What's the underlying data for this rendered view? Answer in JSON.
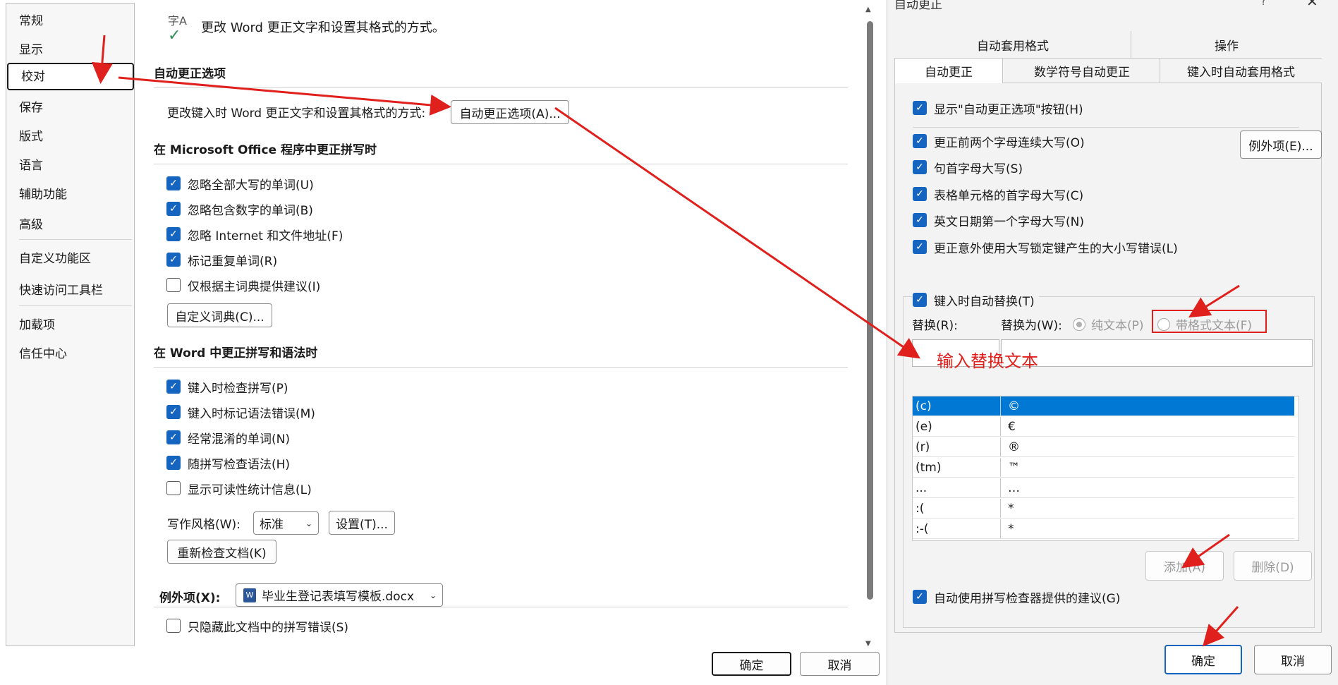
{
  "nav": {
    "items": [
      "常规",
      "显示",
      "校对",
      "保存",
      "版式",
      "语言",
      "辅助功能",
      "高级",
      "自定义功能区",
      "快速访问工具栏",
      "加载项",
      "信任中心"
    ],
    "selected": "校对"
  },
  "main": {
    "header_icon_text": "字A",
    "header_text": "更改 Word 更正文字和设置其格式的方式。",
    "autocorrect_section": {
      "title": "自动更正选项",
      "description": "更改键入时 Word 更正文字和设置其格式的方式:",
      "button": "自动更正选项(A)..."
    },
    "office_section": {
      "title": "在 Microsoft Office 程序中更正拼写时",
      "checkboxes": [
        {
          "label": "忽略全部大写的单词(U)",
          "checked": true
        },
        {
          "label": "忽略包含数字的单词(B)",
          "checked": true
        },
        {
          "label": "忽略 Internet 和文件地址(F)",
          "checked": true
        },
        {
          "label": "标记重复单词(R)",
          "checked": true
        },
        {
          "label": "仅根据主词典提供建议(I)",
          "checked": false
        }
      ],
      "dictionary_button": "自定义词典(C)..."
    },
    "word_section": {
      "title": "在 Word 中更正拼写和语法时",
      "checkboxes": [
        {
          "label": "键入时检查拼写(P)",
          "checked": true
        },
        {
          "label": "键入时标记语法错误(M)",
          "checked": true
        },
        {
          "label": "经常混淆的单词(N)",
          "checked": true
        },
        {
          "label": "随拼写检查语法(H)",
          "checked": true
        },
        {
          "label": "显示可读性统计信息(L)",
          "checked": false
        }
      ],
      "writing_style_label": "写作风格(W):",
      "writing_style_value": "标准",
      "settings_button": "设置(T)...",
      "recheck_button": "重新检查文档(K)"
    },
    "exceptions": {
      "label": "例外项(X):",
      "document": "毕业生登记表填写模板.docx",
      "checkboxes": [
        {
          "label": "只隐藏此文档中的拼写错误(S)",
          "checked": false
        }
      ]
    },
    "ok_button": "确定",
    "cancel_button": "取消"
  },
  "dialog": {
    "title": "自动更正",
    "help_icon": "?",
    "tabs_top": [
      "自动套用格式",
      "操作"
    ],
    "tabs_bottom": [
      "自动更正",
      "数学符号自动更正",
      "键入时自动套用格式"
    ],
    "active_tab": "自动更正",
    "show_button_checkbox": "显示\"自动更正选项\"按钮(H)",
    "checkboxes": [
      {
        "label": "更正前两个字母连续大写(O)",
        "checked": true
      },
      {
        "label": "句首字母大写(S)",
        "checked": true
      },
      {
        "label": "表格单元格的首字母大写(C)",
        "checked": true
      },
      {
        "label": "英文日期第一个字母大写(N)",
        "checked": true
      },
      {
        "label": "更正意外使用大写锁定键产生的大小写错误(L)",
        "checked": true
      }
    ],
    "exceptions_button": "例外项(E)...",
    "replace_as_you_type": "键入时自动替换(T)",
    "replace_label": "替换(R):",
    "with_label": "替换为(W):",
    "plain_text": "纯文本(P)",
    "formatted_text": "带格式文本(F)",
    "annotation": "输入替换文本",
    "table_rows": [
      {
        "replace": "(c)",
        "with": "©"
      },
      {
        "replace": "(e)",
        "with": "€"
      },
      {
        "replace": "(r)",
        "with": "®"
      },
      {
        "replace": "(tm)",
        "with": "™"
      },
      {
        "replace": "...",
        "with": "…"
      },
      {
        "replace": ":(",
        "with": "*"
      },
      {
        "replace": ":-(",
        "with": "*"
      }
    ],
    "add_button": "添加(A)",
    "delete_button": "删除(D)",
    "spell_suggest_checkbox": "自动使用拼写检查器提供的建议(G)",
    "ok_button": "确定",
    "cancel_button": "取消"
  },
  "colors": {
    "accent": "#1565c0",
    "selection": "#0078d4",
    "annotation_red": "#e0201c"
  }
}
